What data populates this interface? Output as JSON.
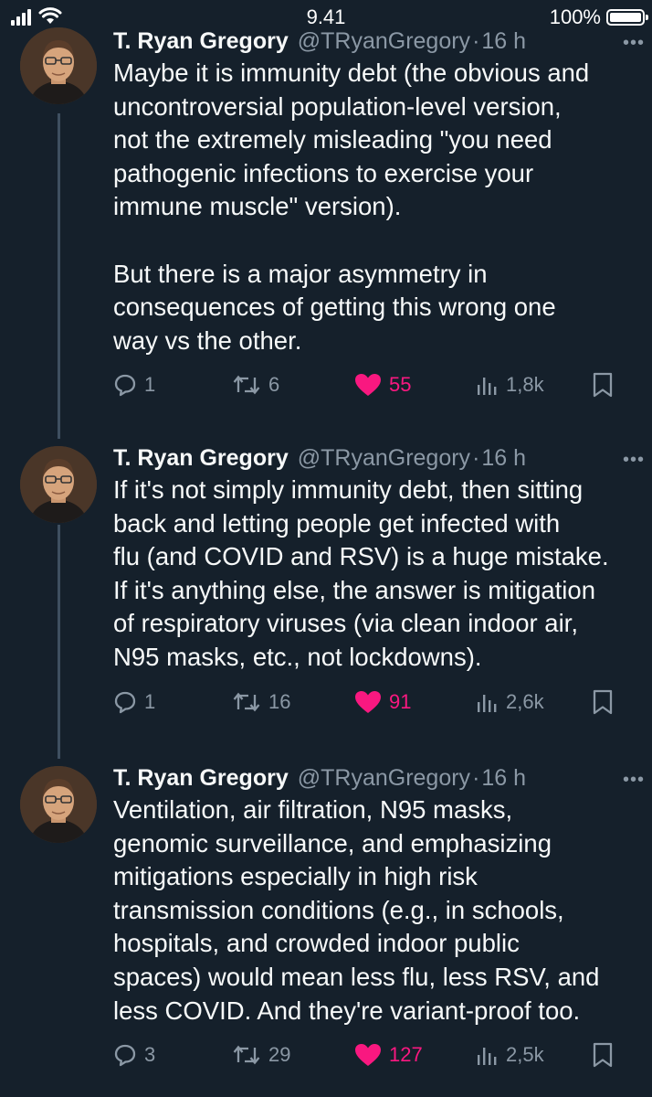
{
  "status_bar": {
    "time": "9.41",
    "battery_text": "100%",
    "battery_level": 1.0
  },
  "tweets": [
    {
      "author_name": "T. Ryan Gregory",
      "handle": "@TRyanGregory",
      "dot": "·",
      "time": "16 h",
      "more": "•••",
      "text": "Maybe it is immunity debt (the obvious and\nuncontroversial population-level version,\nnot the extremely misleading \"you need\npathogenic infections to exercise your\nimmune muscle\" version).\n\nBut there is a major asymmetry in\nconsequences of getting this wrong one\nway vs the other.",
      "replies": "1",
      "retweets": "6",
      "likes": "55",
      "views": "1,8k",
      "liked": true
    },
    {
      "author_name": "T. Ryan Gregory",
      "handle": "@TRyanGregory",
      "dot": "·",
      "time": "16 h",
      "more": "•••",
      "text": "If it's not simply immunity debt, then sitting\nback and letting people get infected with\nflu (and COVID and RSV) is a huge mistake.\nIf it's anything else, the answer is mitigation\nof respiratory viruses (via clean indoor air,\nN95 masks, etc., not lockdowns).",
      "replies": "1",
      "retweets": "16",
      "likes": "91",
      "views": "2,6k",
      "liked": true
    },
    {
      "author_name": "T. Ryan Gregory",
      "handle": "@TRyanGregory",
      "dot": "·",
      "time": "16 h",
      "more": "•••",
      "text": "Ventilation, air filtration, N95 masks,\ngenomic surveillance, and emphasizing\nmitigations especially in high risk\ntransmission conditions (e.g., in schools,\nhospitals, and crowded indoor public\nspaces) would mean less flu, less RSV, and\nless COVID. And they're variant-proof too.",
      "replies": "3",
      "retweets": "29",
      "likes": "127",
      "views": "2,5k",
      "liked": true
    }
  ],
  "colors": {
    "background": "#15202b",
    "text": "#f7f9f9",
    "secondary": "#8b98a5",
    "like": "#f91880",
    "thread_line": "#3e4f60"
  },
  "icons": {
    "reply": "speech-bubble-icon",
    "retweet": "retweet-arrows-icon",
    "like": "heart-icon",
    "views": "bar-chart-icon",
    "bookmark": "bookmark-icon"
  }
}
